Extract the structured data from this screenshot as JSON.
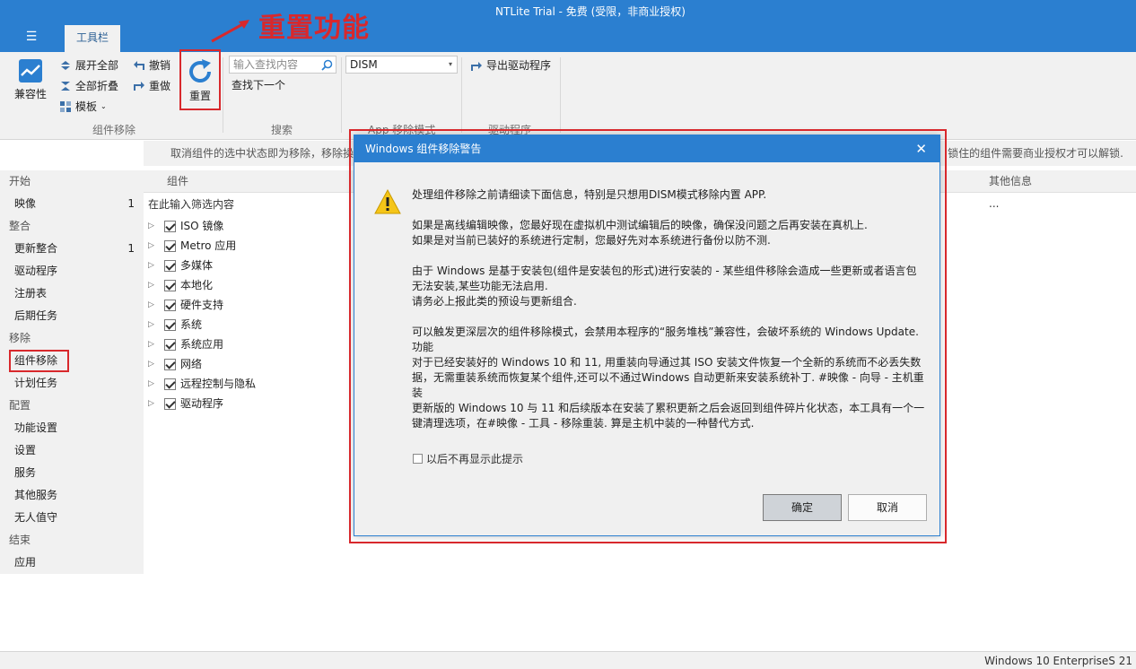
{
  "window": {
    "title": "NTLite Trial - 免费 (受限，非商业授权)",
    "menu_icon": "☰",
    "tab": "工具栏"
  },
  "annotation": {
    "label": "重置功能",
    "color": "#d8282c"
  },
  "ribbon": {
    "compat_label": "兼容性",
    "expand_all": "展开全部",
    "collapse_all": "全部折叠",
    "template": "模板",
    "undo": "撤销",
    "redo": "重做",
    "reset": "重置",
    "group_component_remove": "组件移除",
    "search_placeholder": "输入查找内容",
    "find_next": "查找下一个",
    "group_search": "搜索",
    "dism_value": "DISM",
    "group_app_remove": "App 移除模式",
    "export_drivers": "导出驱动程序",
    "group_drivers": "驱动程序"
  },
  "infobar": {
    "left": "取消组件的选中状态即为移除，移除操",
    "right": "锁住的组件需要商业授权才可以解锁."
  },
  "sidebar": {
    "sections": [
      {
        "label": "开始",
        "items": [
          {
            "label": "映像",
            "count": "1"
          }
        ]
      },
      {
        "label": "整合",
        "items": [
          {
            "label": "更新整合",
            "count": "1"
          },
          {
            "label": "驱动程序",
            "count": ""
          },
          {
            "label": "注册表",
            "count": ""
          },
          {
            "label": "后期任务",
            "count": ""
          }
        ]
      },
      {
        "label": "移除",
        "items": [
          {
            "label": "组件移除",
            "count": ""
          },
          {
            "label": "计划任务",
            "count": ""
          }
        ]
      },
      {
        "label": "配置",
        "items": [
          {
            "label": "功能设置",
            "count": ""
          },
          {
            "label": "设置",
            "count": ""
          },
          {
            "label": "服务",
            "count": ""
          },
          {
            "label": "其他服务",
            "count": ""
          },
          {
            "label": "无人值守",
            "count": ""
          }
        ]
      },
      {
        "label": "结束",
        "items": [
          {
            "label": "应用",
            "count": ""
          }
        ]
      }
    ]
  },
  "grid": {
    "col_component": "组件",
    "col_other": "其他信息",
    "filter_placeholder": "在此输入筛选内容",
    "more": "...",
    "tree": [
      "ISO 镜像",
      "Metro 应用",
      "多媒体",
      "本地化",
      "硬件支持",
      "系统",
      "系统应用",
      "网络",
      "远程控制与隐私",
      "驱动程序"
    ]
  },
  "dialog": {
    "title": "Windows 组件移除警告",
    "close": "✕",
    "paragraphs": [
      [
        "处理组件移除之前请细读下面信息，特别是只想用DISM模式移除内置 APP."
      ],
      [
        "如果是离线编辑映像，您最好现在虚拟机中测试编辑后的映像，确保没问题之后再安装在真机上.",
        "如果是对当前已装好的系统进行定制，您最好先对本系统进行备份以防不测."
      ],
      [
        "由于 Windows 是基于安装包(组件是安装包的形式)进行安装的 - 某些组件移除会造成一些更新或者语言包",
        "无法安装,某些功能无法启用.",
        "请务必上报此类的预设与更新组合."
      ],
      [
        "可以触发更深层次的组件移除模式，会禁用本程序的“服务堆栈”兼容性，会破坏系统的 Windows Update.",
        "功能",
        "对于已经安装好的 Windows 10 和 11, 用重装向导通过其 ISO 安装文件恢复一个全新的系统而不必丢失数",
        "据，无需重装系统而恢复某个组件,还可以不通过Windows 自动更新来安装系统补丁. #映像 - 向导 - 主机重",
        "装",
        "更新版的 Windows 10 与 11 和后续版本在安装了累积更新之后会返回到组件碎片化状态，本工具有一个一",
        "键清理选项，在#映像 - 工具 - 移除重装. 算是主机中装的一种替代方式."
      ]
    ],
    "checkbox_label": "以后不再显示此提示",
    "ok": "确定",
    "cancel": "取消"
  },
  "status": {
    "text": "Windows 10 EnterpriseS 21"
  },
  "colors": {
    "accent": "#2b7fd0",
    "highlight": "#d8282c",
    "ribbon_bg": "#f1f1f1"
  }
}
